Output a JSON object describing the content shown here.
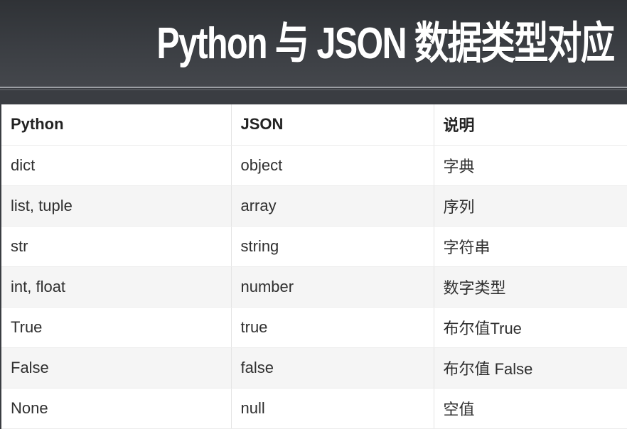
{
  "slide": {
    "title": "Python 与 JSON 数据类型对应"
  },
  "table": {
    "headers": [
      "Python",
      "JSON",
      "说明"
    ],
    "rows": [
      [
        "dict",
        "object",
        "字典"
      ],
      [
        "list, tuple",
        "array",
        "序列"
      ],
      [
        "str",
        "string",
        "字符串"
      ],
      [
        "int, float",
        "number",
        "数字类型"
      ],
      [
        "True",
        "true",
        "布尔值True"
      ],
      [
        "False",
        "false",
        "布尔值 False"
      ],
      [
        "None",
        "null",
        "空值"
      ]
    ]
  },
  "colors": {
    "header_bg": "#3a3d42",
    "title_text": "#ffffff",
    "row_stripe": "#f5f5f5"
  }
}
